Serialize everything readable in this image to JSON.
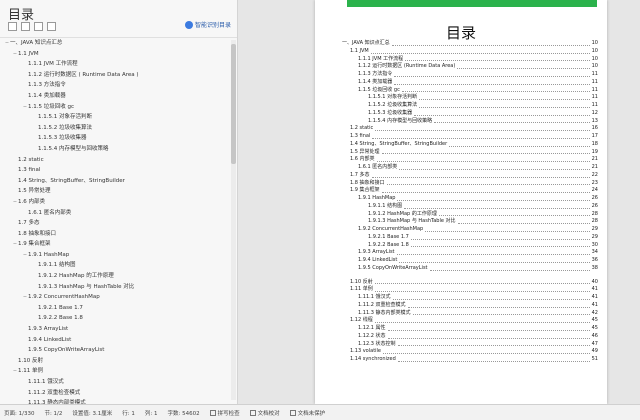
{
  "nav": {
    "title": "目录",
    "smart_button": "智能识别目录",
    "items": [
      {
        "text": "一、JAVA 知识点汇总",
        "indent": 0,
        "tw": "−"
      },
      {
        "text": "1.1 JVM",
        "indent": 1,
        "tw": "−"
      },
      {
        "text": "1.1.1 JVM 工作流程",
        "indent": 2,
        "tw": ""
      },
      {
        "text": "1.1.2 运行时数据区 ( Runtime Data Area )",
        "indent": 2,
        "tw": ""
      },
      {
        "text": "1.1.3 方法指令",
        "indent": 2,
        "tw": ""
      },
      {
        "text": "1.1.4 类加载器",
        "indent": 2,
        "tw": ""
      },
      {
        "text": "1.1.5 垃圾回收 gc",
        "indent": 2,
        "tw": "−"
      },
      {
        "text": "1.1.5.1 对象存活判断",
        "indent": 3,
        "tw": ""
      },
      {
        "text": "1.1.5.2 垃圾收集算法",
        "indent": 3,
        "tw": ""
      },
      {
        "text": "1.1.5.3 垃圾收集器",
        "indent": 3,
        "tw": ""
      },
      {
        "text": "1.1.5.4 内存模型与回收策略",
        "indent": 3,
        "tw": ""
      },
      {
        "text": "1.2 static",
        "indent": 1,
        "tw": ""
      },
      {
        "text": "1.3 final",
        "indent": 1,
        "tw": ""
      },
      {
        "text": "1.4 String、StringBuffer、StringBuilder",
        "indent": 1,
        "tw": ""
      },
      {
        "text": "1.5 异常处理",
        "indent": 1,
        "tw": ""
      },
      {
        "text": "1.6 内部类",
        "indent": 1,
        "tw": "−"
      },
      {
        "text": "1.6.1 匿名内部类",
        "indent": 2,
        "tw": ""
      },
      {
        "text": "1.7 多态",
        "indent": 1,
        "tw": ""
      },
      {
        "text": "1.8 抽象和接口",
        "indent": 1,
        "tw": ""
      },
      {
        "text": "1.9 集合框架",
        "indent": 1,
        "tw": "−"
      },
      {
        "text": "1.9.1 HashMap",
        "indent": 2,
        "tw": "−"
      },
      {
        "text": "1.9.1.1 结构图",
        "indent": 3,
        "tw": ""
      },
      {
        "text": "1.9.1.2 HashMap 的工作原理",
        "indent": 3,
        "tw": ""
      },
      {
        "text": "1.9.1.3 HashMap 与 HashTable 对比",
        "indent": 3,
        "tw": ""
      },
      {
        "text": "1.9.2 ConcurrentHashMap",
        "indent": 2,
        "tw": "−"
      },
      {
        "text": "1.9.2.1 Base 1.7",
        "indent": 3,
        "tw": ""
      },
      {
        "text": "1.9.2.2 Base 1.8",
        "indent": 3,
        "tw": ""
      },
      {
        "text": "1.9.3 ArrayList",
        "indent": 2,
        "tw": ""
      },
      {
        "text": "1.9.4 LinkedList",
        "indent": 2,
        "tw": ""
      },
      {
        "text": "1.9.5 CopyOnWriteArrayList",
        "indent": 2,
        "tw": ""
      },
      {
        "text": "1.10 反射",
        "indent": 1,
        "tw": ""
      },
      {
        "text": "1.11 单例",
        "indent": 1,
        "tw": "−"
      },
      {
        "text": "1.11.1 饿汉式",
        "indent": 2,
        "tw": ""
      },
      {
        "text": "1.11.2 双重检查模式",
        "indent": 2,
        "tw": ""
      },
      {
        "text": "1.11.3 静态内部类模式",
        "indent": 2,
        "tw": ""
      },
      {
        "text": "1.12 线程",
        "indent": 1,
        "tw": "−"
      }
    ]
  },
  "page": {
    "title": "目录",
    "toc": [
      {
        "text": "一、JAVA 知识点汇总",
        "indent": 0,
        "page": "10"
      },
      {
        "text": "1.1 JVM",
        "indent": 1,
        "page": "10"
      },
      {
        "text": "1.1.1 JVM 工作流程",
        "indent": 2,
        "page": "10"
      },
      {
        "text": "1.1.2 运行时数据区 (Runtime Data Area)",
        "indent": 2,
        "page": "10"
      },
      {
        "text": "1.1.3 方法指令",
        "indent": 2,
        "page": "11"
      },
      {
        "text": "1.1.4 类加载器",
        "indent": 2,
        "page": "11"
      },
      {
        "text": "1.1.5 垃圾回收 gc",
        "indent": 2,
        "page": "11"
      },
      {
        "text": "1.1.5.1 对象存活判断",
        "indent": 3,
        "page": "11"
      },
      {
        "text": "1.1.5.2 垃圾收集算法",
        "indent": 3,
        "page": "11"
      },
      {
        "text": "1.1.5.3 垃圾收集器",
        "indent": 3,
        "page": "12"
      },
      {
        "text": "1.1.5.4 内存模型与回收策略",
        "indent": 3,
        "page": "13"
      },
      {
        "text": "1.2 static",
        "indent": 1,
        "page": "16"
      },
      {
        "text": "1.3 final",
        "indent": 1,
        "page": "17"
      },
      {
        "text": "1.4 String、StringBuffer、StringBuilder",
        "indent": 1,
        "page": "18"
      },
      {
        "text": "1.5 异常处理",
        "indent": 1,
        "page": "19"
      },
      {
        "text": "1.6 内部类",
        "indent": 1,
        "page": "21"
      },
      {
        "text": "1.6.1 匿名内部类",
        "indent": 2,
        "page": "21"
      },
      {
        "text": "1.7 多态",
        "indent": 1,
        "page": "22"
      },
      {
        "text": "1.8 抽象和接口",
        "indent": 1,
        "page": "23"
      },
      {
        "text": "1.9 集合框架",
        "indent": 1,
        "page": "24"
      },
      {
        "text": "1.9.1 HashMap",
        "indent": 2,
        "page": "26"
      },
      {
        "text": "1.9.1.1 结构图",
        "indent": 3,
        "page": "26"
      },
      {
        "text": "1.9.1.2 HashMap 的工作原理",
        "indent": 3,
        "page": "28"
      },
      {
        "text": "1.9.1.3 HashMap 与 HashTable 对比",
        "indent": 3,
        "page": "28"
      },
      {
        "text": "1.9.2 ConcurrentHashMap",
        "indent": 2,
        "page": "29"
      },
      {
        "text": "1.9.2.1 Base 1.7",
        "indent": 3,
        "page": "29"
      },
      {
        "text": "1.9.2.2 Base 1.8",
        "indent": 3,
        "page": "30"
      },
      {
        "text": "1.9.3 ArrayList",
        "indent": 2,
        "page": "34"
      },
      {
        "text": "1.9.4 LinkedList",
        "indent": 2,
        "page": "36"
      },
      {
        "text": "1.9.5 CopyOnWriteArrayList",
        "indent": 2,
        "page": "38"
      },
      {
        "text": "",
        "indent": 0,
        "page": "",
        "gap": true
      },
      {
        "text": "1.10 反射",
        "indent": 1,
        "page": "40"
      },
      {
        "text": "1.11 单例",
        "indent": 1,
        "page": "41"
      },
      {
        "text": "1.11.1 饿汉式",
        "indent": 2,
        "page": "41"
      },
      {
        "text": "1.11.2 双重检查模式",
        "indent": 2,
        "page": "41"
      },
      {
        "text": "1.11.3 静态内部类模式",
        "indent": 2,
        "page": "42"
      },
      {
        "text": "1.12 线程",
        "indent": 1,
        "page": "45"
      },
      {
        "text": "1.12.1 属性",
        "indent": 2,
        "page": "45"
      },
      {
        "text": "1.12.2 状态",
        "indent": 2,
        "page": "46"
      },
      {
        "text": "1.12.3 状态控制",
        "indent": 2,
        "page": "47"
      },
      {
        "text": "1.13 volatile",
        "indent": 1,
        "page": "49"
      },
      {
        "text": "1.14 synchronized",
        "indent": 1,
        "page": "51"
      }
    ]
  },
  "status": {
    "page_info": "页面: 1/330",
    "section": "节: 1/2",
    "setting": "设置值: 3.1厘米",
    "row": "行: 1",
    "col": "列: 1",
    "word_count": "字数: 54602",
    "spell_check": "拼写检查",
    "doc_check": "文档校对",
    "doc_unprotected": "文档未保护"
  },
  "colors": {
    "accent": "#2bb24c",
    "link": "#2a5caa"
  }
}
